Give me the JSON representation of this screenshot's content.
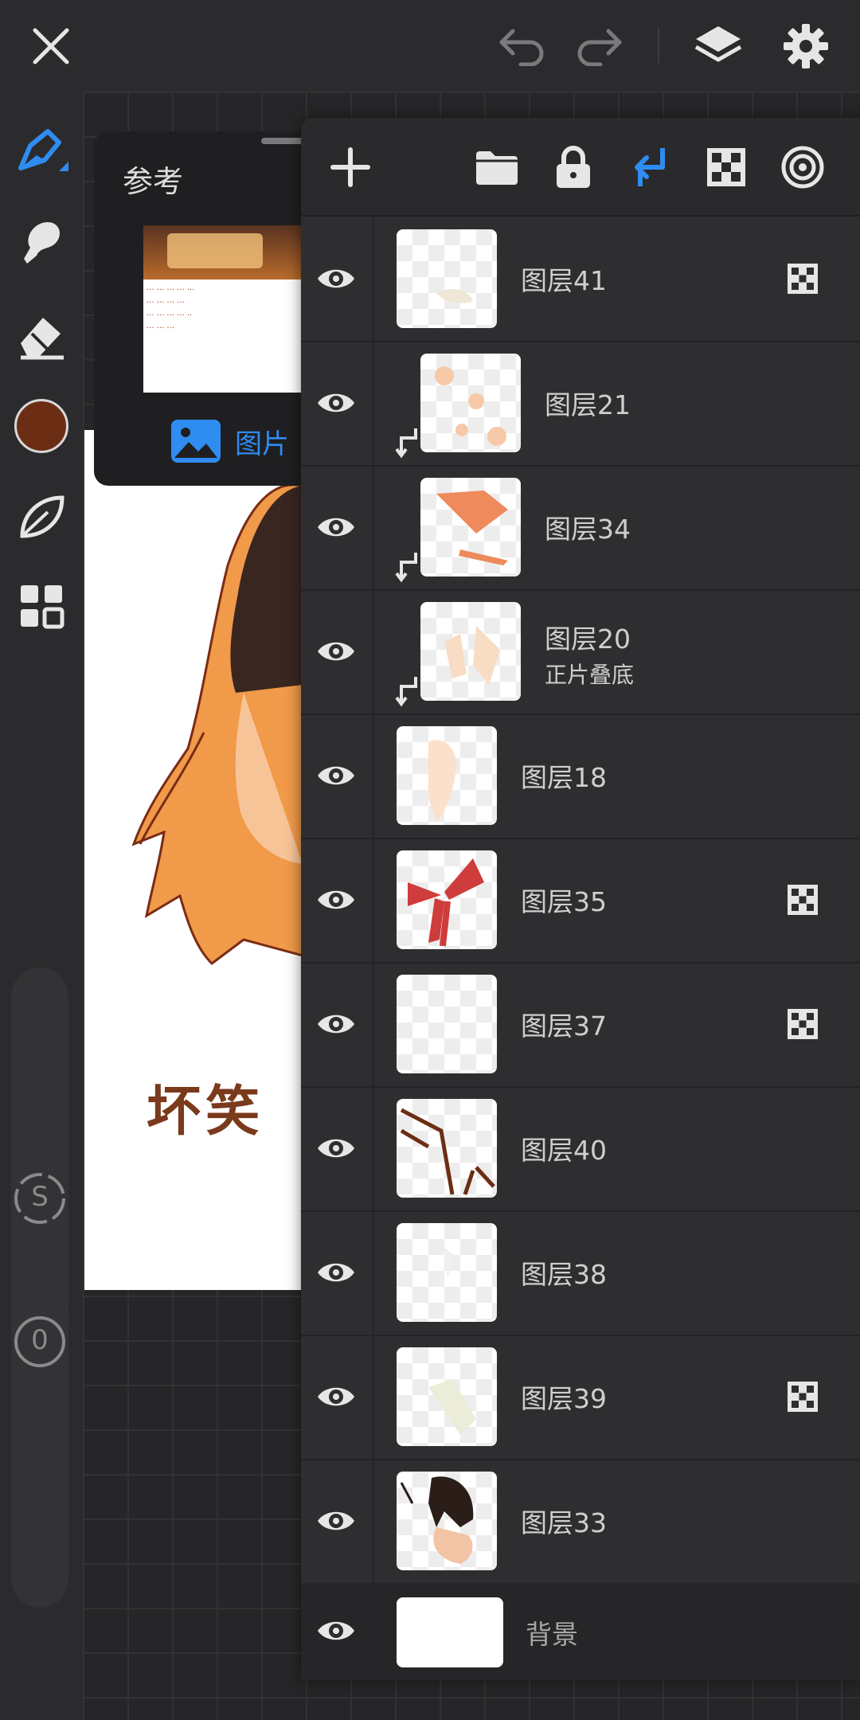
{
  "topbar": {
    "close_icon": "close-icon",
    "undo_icon": "undo-icon",
    "redo_icon": "redo-icon",
    "layers_icon": "layers-icon",
    "settings_icon": "gear-icon"
  },
  "sidebar": {
    "tools": [
      "pen-tool-icon",
      "blend-tool-icon",
      "eraser-tool-icon",
      "color-swatch",
      "leaf-brush-icon",
      "grid-menu-icon"
    ],
    "current_color": "#6b2e14",
    "size_label": "S",
    "opacity_value": "0"
  },
  "reference": {
    "title": "参考",
    "image_button": "图片",
    "thumb_lines": [
      "··· ··· ··· ··· ···",
      "··· ··· ··· ···",
      "··· ··· ··· ··· ··",
      "··· ··· ···"
    ]
  },
  "artwork": {
    "caption": "坏笑"
  },
  "colors": {
    "accent": "#2f8cf0",
    "panel": "#2e2e30",
    "topbar": "#2b2b2d"
  },
  "layers": {
    "toolbar": [
      "add-layer-icon",
      "folder-icon",
      "lock-icon",
      "clipping-mask-icon",
      "alpha-lock-icon",
      "ring-icon"
    ],
    "items": [
      {
        "name": "图层41",
        "blend": "",
        "clipped": false,
        "alpha_locked": true
      },
      {
        "name": "图层21",
        "blend": "",
        "clipped": true,
        "alpha_locked": false
      },
      {
        "name": "图层34",
        "blend": "",
        "clipped": true,
        "alpha_locked": false
      },
      {
        "name": "图层20",
        "blend": "正片叠底",
        "clipped": true,
        "alpha_locked": false
      },
      {
        "name": "图层18",
        "blend": "",
        "clipped": false,
        "alpha_locked": false
      },
      {
        "name": "图层35",
        "blend": "",
        "clipped": false,
        "alpha_locked": true
      },
      {
        "name": "图层37",
        "blend": "",
        "clipped": false,
        "alpha_locked": true
      },
      {
        "name": "图层40",
        "blend": "",
        "clipped": false,
        "alpha_locked": false
      },
      {
        "name": "图层38",
        "blend": "",
        "clipped": false,
        "alpha_locked": false
      },
      {
        "name": "图层39",
        "blend": "",
        "clipped": false,
        "alpha_locked": true
      },
      {
        "name": "图层33",
        "blend": "",
        "clipped": false,
        "alpha_locked": false
      },
      {
        "name": "背景",
        "blend": "",
        "clipped": false,
        "alpha_locked": false
      }
    ]
  }
}
